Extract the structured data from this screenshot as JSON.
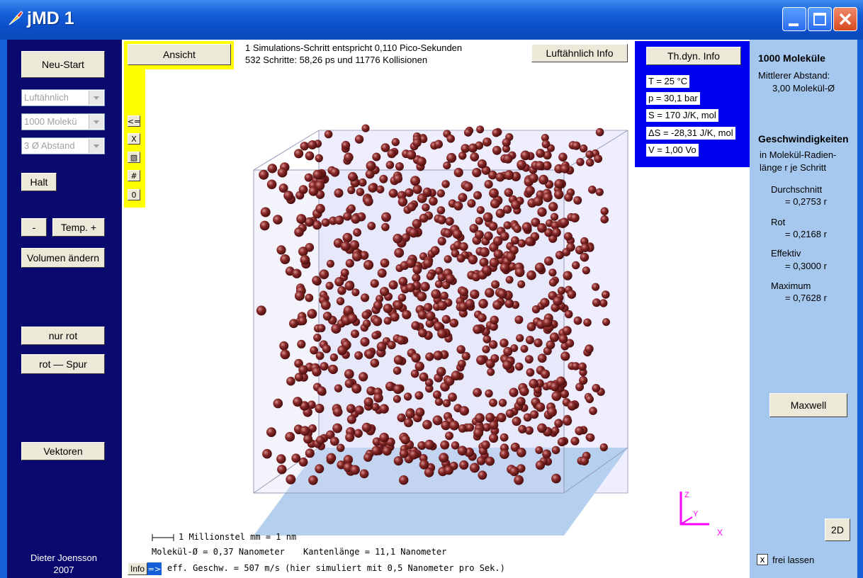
{
  "window": {
    "title": "jMD 1"
  },
  "left": {
    "restart": "Neu-Start",
    "gas_select": "Luftähnlich",
    "molecules_select": "1000 Molekü",
    "distance_select": "3 Ø Abstand",
    "halt": "Halt",
    "temp_minus": "-",
    "temp_plus": "Temp. +",
    "volume": "Volumen ändern",
    "only_rot": "nur rot",
    "rot_trace": "rot — Spur",
    "vectors": "Vektoren",
    "author": "Dieter Joensson",
    "year": "2007"
  },
  "center": {
    "view_button": "Ansicht",
    "sim_step_line": "1 Simulations-Schritt entspricht 0,110 Pico-Sekunden",
    "steps_line": "532 Schritte:  58,26 ps  und 11776 Kollisionen",
    "air_info_button": "Luftähnlich  Info",
    "thdyn_button": "Th.dyn.  Info",
    "small_buttons": [
      "<=",
      "X",
      "▧",
      "#",
      "0"
    ],
    "thdyn_values": [
      "T = 25 °C",
      "p = 30,1 bar",
      "S = 170 J/K, mol",
      "ΔS = -28,31 J/K, mol",
      "V = 1,00 Vo"
    ],
    "scale_text": "1 Millionstel mm = 1 nm",
    "molecule_text": "Molekül-Ø = 0,37 Nanometer",
    "edge_text": "Kantenlänge = 11,1 Nanometer",
    "info_button": "Info",
    "arrow_button": "=>",
    "speed_text": "eff. Geschw. =   507 m/s   (hier simuliert mit  0,5 Nanometer pro Sek.)",
    "axis_z": "Z",
    "axis_y": "Y",
    "axis_x": "X"
  },
  "right": {
    "count": "1000  Moleküle",
    "mean_dist_label": "Mittlerer Abstand:",
    "mean_dist_value": "3,00  Molekül-Ø",
    "speeds_title": "Geschwindigkeiten",
    "speeds_sub1": "in Molekül-Radien-",
    "speeds_sub2": "länge  r  je Schritt",
    "avg_label": "Durchschnitt",
    "avg_value": "= 0,2753 r",
    "rot_label": "Rot",
    "rot_value": "= 0,2168 r",
    "eff_label": "Effektiv",
    "eff_value": "= 0,3000 r",
    "max_label": "Maximum",
    "max_value": "= 0,7628 r",
    "maxwell": "Maxwell",
    "btn_2d": "2D",
    "checkbox": "x",
    "free_label": "frei lassen"
  },
  "colors": {
    "titlebar": "#0b4fc8",
    "left_panel": "#0a0a6e",
    "right_panel": "#a6c8ee",
    "thdyn_panel": "#0000f0",
    "yellow_bar": "#ffff00",
    "molecule": "#7a2424",
    "axis": "#ff00ff"
  }
}
